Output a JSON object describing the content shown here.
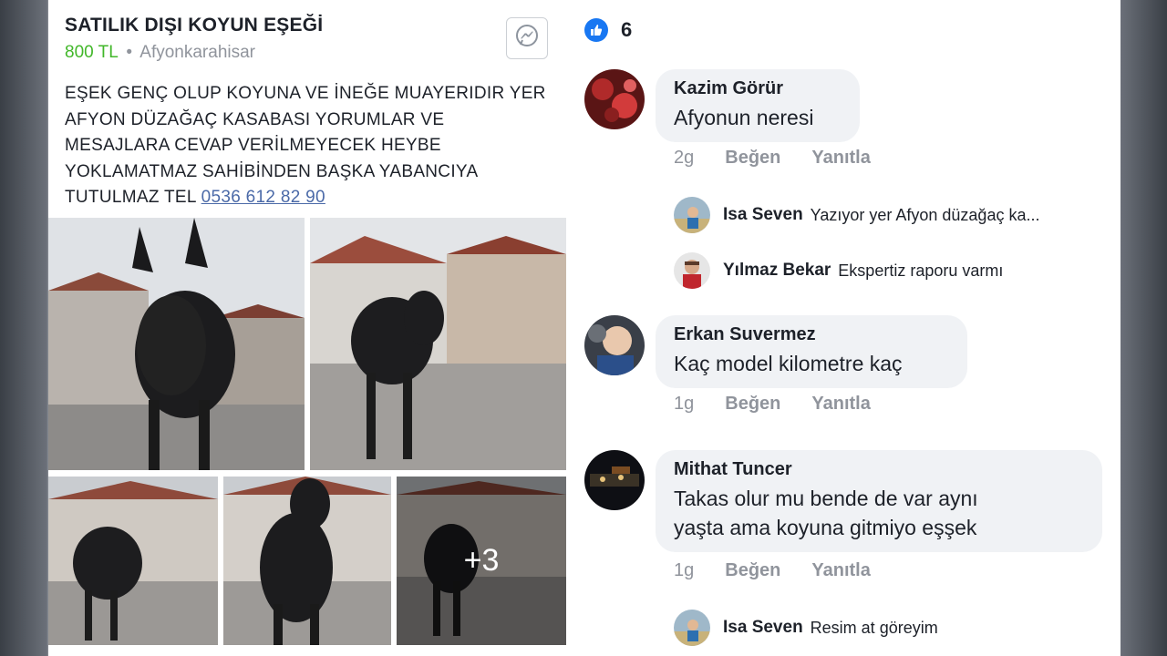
{
  "listing": {
    "title": "SATILIK DIŞI KOYUN EŞEĞİ",
    "price": "800 TL",
    "separator": "•",
    "location": "Afyonkarahisar",
    "description": "EŞEK GENÇ OLUP KOYUNA VE İNEĞE MUAYERIDIR YER AFYON DÜZAĞAÇ KASABASI YORUMLAR VE MESAJLARA CEVAP VERİLMEYECEK HEYBE YOKLAMATMAZ SAHİBİNDEN BAŞKA YABANCIYA TUTULMAZ TEL",
    "phone": "0536 612 82 90",
    "more_photos": "+3",
    "messenger_icon": "messenger-icon"
  },
  "reactions": {
    "icon": "like-icon",
    "count": "6"
  },
  "comments": [
    {
      "author": "Kazim Görür",
      "text": "Afyonun neresi",
      "time": "2g",
      "like_label": "Beğen",
      "reply_label": "Yanıtla",
      "replies": [
        {
          "author": "Isa Seven",
          "text": "Yazıyor yer Afyon düzağaç ka..."
        },
        {
          "author": "Yılmaz Bekar",
          "text": "Ekspertiz raporu varmı"
        }
      ]
    },
    {
      "author": "Erkan Suvermez",
      "text": "Kaç model kilometre kaç",
      "time": "1g",
      "like_label": "Beğen",
      "reply_label": "Yanıtla"
    },
    {
      "author": "Mithat Tuncer",
      "text_line1": "Takas olur mu bende de var aynı",
      "text_line2": "yaşta ama koyuna gitmiyo eşşek",
      "time": "1g",
      "like_label": "Beğen",
      "reply_label": "Yanıtla",
      "replies": [
        {
          "author": "Isa Seven",
          "text": "Resim at göreyim"
        }
      ]
    }
  ],
  "colors": {
    "price_green": "#42b72a",
    "like_blue": "#1877f2",
    "bubble_gray": "#f0f2f5",
    "meta_gray": "#90949c"
  }
}
